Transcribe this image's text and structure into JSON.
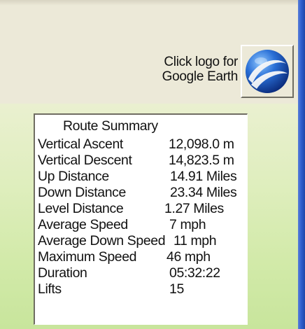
{
  "logo": {
    "caption_line1": "Click logo for",
    "caption_line2": "Google Earth",
    "icon": "google-earth-globe-icon"
  },
  "summary": {
    "title": "Route Summary",
    "rows": [
      {
        "label": "Vertical Ascent",
        "value": "12,098.0 m"
      },
      {
        "label": "Vertical Descent",
        "value": "14,823.5 m"
      },
      {
        "label": "Up Distance",
        "value": "14.91 Miles"
      },
      {
        "label": "Down Distance",
        "value": "23.34 Miles"
      },
      {
        "label": "Level Distance",
        "value": "1.27 Miles"
      },
      {
        "label": "Average Speed",
        "value": "7 mph"
      },
      {
        "label": "Average Down Speed",
        "value": "11 mph"
      },
      {
        "label": "Maximum Speed",
        "value": "46 mph"
      },
      {
        "label": "Duration",
        "value": "05:32:22"
      },
      {
        "label": "Lifts",
        "value": "15"
      }
    ]
  },
  "colors": {
    "window_background": "#ece9d8",
    "gradient_bottom": "#c8e59c",
    "accent_bar": "#2f5fcf"
  }
}
